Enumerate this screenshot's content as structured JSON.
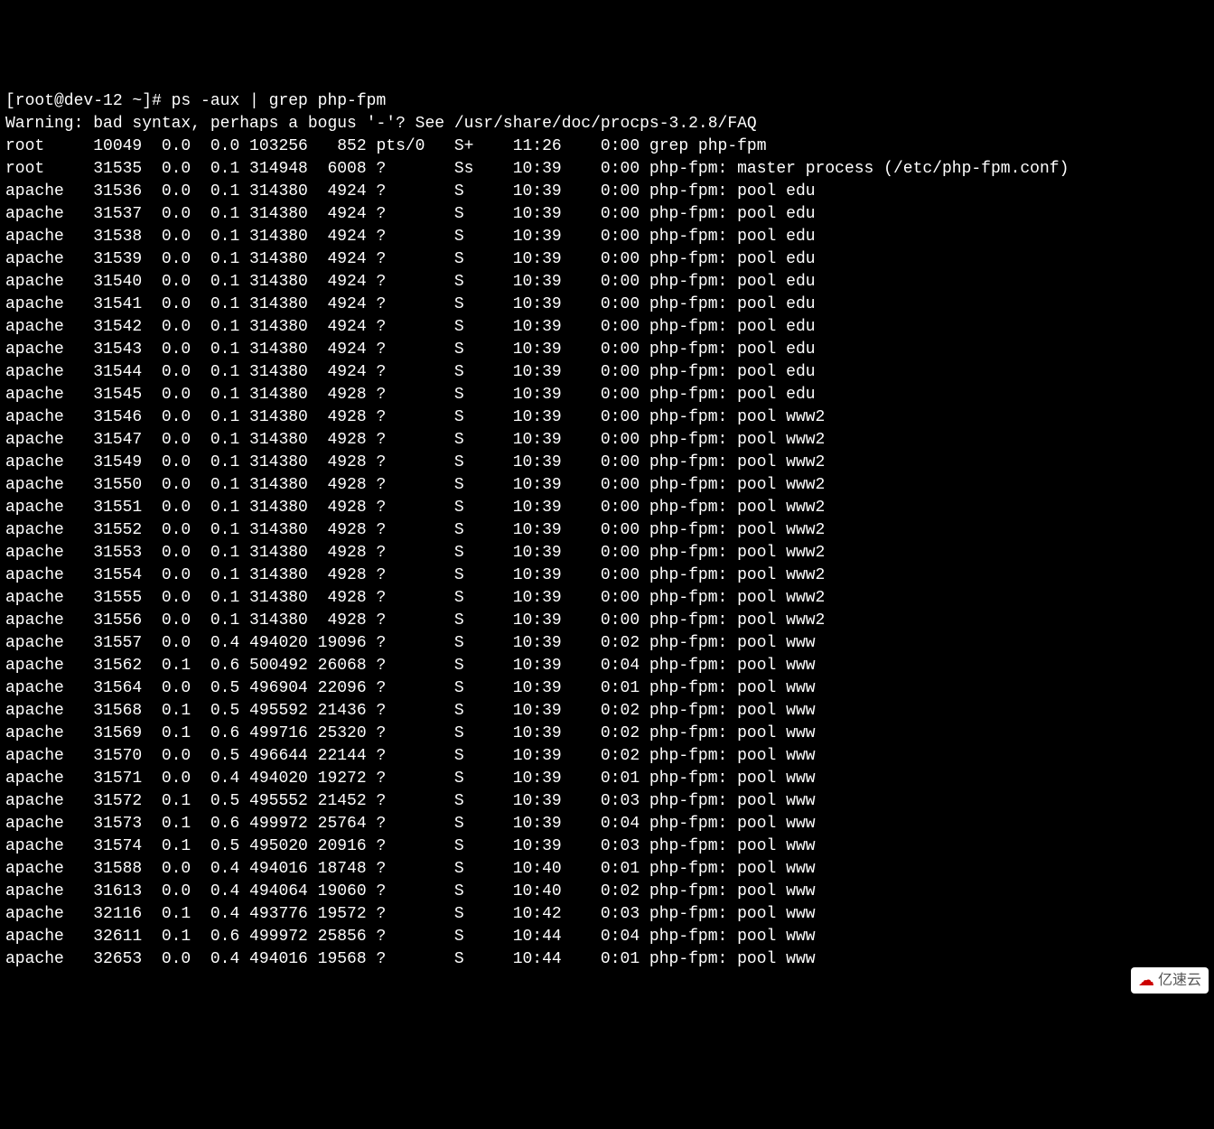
{
  "prompt_line": "[root@dev-12 ~]# ps -aux | grep php-fpm",
  "warning_line": "Warning: bad syntax, perhaps a bogus '-'? See /usr/share/doc/procps-3.2.8/FAQ",
  "rows": [
    {
      "user": "root",
      "pid": "10049",
      "cpu": "0.0",
      "mem": "0.0",
      "vsz": "103256",
      "rss": "852",
      "tty": "pts/0",
      "stat": "S+",
      "start": "11:26",
      "time": "0:00",
      "cmd": "grep php-fpm"
    },
    {
      "user": "root",
      "pid": "31535",
      "cpu": "0.0",
      "mem": "0.1",
      "vsz": "314948",
      "rss": "6008",
      "tty": "?",
      "stat": "Ss",
      "start": "10:39",
      "time": "0:00",
      "cmd": "php-fpm: master process (/etc/php-fpm.conf)"
    },
    {
      "user": "apache",
      "pid": "31536",
      "cpu": "0.0",
      "mem": "0.1",
      "vsz": "314380",
      "rss": "4924",
      "tty": "?",
      "stat": "S",
      "start": "10:39",
      "time": "0:00",
      "cmd": "php-fpm: pool edu"
    },
    {
      "user": "apache",
      "pid": "31537",
      "cpu": "0.0",
      "mem": "0.1",
      "vsz": "314380",
      "rss": "4924",
      "tty": "?",
      "stat": "S",
      "start": "10:39",
      "time": "0:00",
      "cmd": "php-fpm: pool edu"
    },
    {
      "user": "apache",
      "pid": "31538",
      "cpu": "0.0",
      "mem": "0.1",
      "vsz": "314380",
      "rss": "4924",
      "tty": "?",
      "stat": "S",
      "start": "10:39",
      "time": "0:00",
      "cmd": "php-fpm: pool edu"
    },
    {
      "user": "apache",
      "pid": "31539",
      "cpu": "0.0",
      "mem": "0.1",
      "vsz": "314380",
      "rss": "4924",
      "tty": "?",
      "stat": "S",
      "start": "10:39",
      "time": "0:00",
      "cmd": "php-fpm: pool edu"
    },
    {
      "user": "apache",
      "pid": "31540",
      "cpu": "0.0",
      "mem": "0.1",
      "vsz": "314380",
      "rss": "4924",
      "tty": "?",
      "stat": "S",
      "start": "10:39",
      "time": "0:00",
      "cmd": "php-fpm: pool edu"
    },
    {
      "user": "apache",
      "pid": "31541",
      "cpu": "0.0",
      "mem": "0.1",
      "vsz": "314380",
      "rss": "4924",
      "tty": "?",
      "stat": "S",
      "start": "10:39",
      "time": "0:00",
      "cmd": "php-fpm: pool edu"
    },
    {
      "user": "apache",
      "pid": "31542",
      "cpu": "0.0",
      "mem": "0.1",
      "vsz": "314380",
      "rss": "4924",
      "tty": "?",
      "stat": "S",
      "start": "10:39",
      "time": "0:00",
      "cmd": "php-fpm: pool edu"
    },
    {
      "user": "apache",
      "pid": "31543",
      "cpu": "0.0",
      "mem": "0.1",
      "vsz": "314380",
      "rss": "4924",
      "tty": "?",
      "stat": "S",
      "start": "10:39",
      "time": "0:00",
      "cmd": "php-fpm: pool edu"
    },
    {
      "user": "apache",
      "pid": "31544",
      "cpu": "0.0",
      "mem": "0.1",
      "vsz": "314380",
      "rss": "4924",
      "tty": "?",
      "stat": "S",
      "start": "10:39",
      "time": "0:00",
      "cmd": "php-fpm: pool edu"
    },
    {
      "user": "apache",
      "pid": "31545",
      "cpu": "0.0",
      "mem": "0.1",
      "vsz": "314380",
      "rss": "4928",
      "tty": "?",
      "stat": "S",
      "start": "10:39",
      "time": "0:00",
      "cmd": "php-fpm: pool edu"
    },
    {
      "user": "apache",
      "pid": "31546",
      "cpu": "0.0",
      "mem": "0.1",
      "vsz": "314380",
      "rss": "4928",
      "tty": "?",
      "stat": "S",
      "start": "10:39",
      "time": "0:00",
      "cmd": "php-fpm: pool www2"
    },
    {
      "user": "apache",
      "pid": "31547",
      "cpu": "0.0",
      "mem": "0.1",
      "vsz": "314380",
      "rss": "4928",
      "tty": "?",
      "stat": "S",
      "start": "10:39",
      "time": "0:00",
      "cmd": "php-fpm: pool www2"
    },
    {
      "user": "apache",
      "pid": "31549",
      "cpu": "0.0",
      "mem": "0.1",
      "vsz": "314380",
      "rss": "4928",
      "tty": "?",
      "stat": "S",
      "start": "10:39",
      "time": "0:00",
      "cmd": "php-fpm: pool www2"
    },
    {
      "user": "apache",
      "pid": "31550",
      "cpu": "0.0",
      "mem": "0.1",
      "vsz": "314380",
      "rss": "4928",
      "tty": "?",
      "stat": "S",
      "start": "10:39",
      "time": "0:00",
      "cmd": "php-fpm: pool www2"
    },
    {
      "user": "apache",
      "pid": "31551",
      "cpu": "0.0",
      "mem": "0.1",
      "vsz": "314380",
      "rss": "4928",
      "tty": "?",
      "stat": "S",
      "start": "10:39",
      "time": "0:00",
      "cmd": "php-fpm: pool www2"
    },
    {
      "user": "apache",
      "pid": "31552",
      "cpu": "0.0",
      "mem": "0.1",
      "vsz": "314380",
      "rss": "4928",
      "tty": "?",
      "stat": "S",
      "start": "10:39",
      "time": "0:00",
      "cmd": "php-fpm: pool www2"
    },
    {
      "user": "apache",
      "pid": "31553",
      "cpu": "0.0",
      "mem": "0.1",
      "vsz": "314380",
      "rss": "4928",
      "tty": "?",
      "stat": "S",
      "start": "10:39",
      "time": "0:00",
      "cmd": "php-fpm: pool www2"
    },
    {
      "user": "apache",
      "pid": "31554",
      "cpu": "0.0",
      "mem": "0.1",
      "vsz": "314380",
      "rss": "4928",
      "tty": "?",
      "stat": "S",
      "start": "10:39",
      "time": "0:00",
      "cmd": "php-fpm: pool www2"
    },
    {
      "user": "apache",
      "pid": "31555",
      "cpu": "0.0",
      "mem": "0.1",
      "vsz": "314380",
      "rss": "4928",
      "tty": "?",
      "stat": "S",
      "start": "10:39",
      "time": "0:00",
      "cmd": "php-fpm: pool www2"
    },
    {
      "user": "apache",
      "pid": "31556",
      "cpu": "0.0",
      "mem": "0.1",
      "vsz": "314380",
      "rss": "4928",
      "tty": "?",
      "stat": "S",
      "start": "10:39",
      "time": "0:00",
      "cmd": "php-fpm: pool www2"
    },
    {
      "user": "apache",
      "pid": "31557",
      "cpu": "0.0",
      "mem": "0.4",
      "vsz": "494020",
      "rss": "19096",
      "tty": "?",
      "stat": "S",
      "start": "10:39",
      "time": "0:02",
      "cmd": "php-fpm: pool www"
    },
    {
      "user": "apache",
      "pid": "31562",
      "cpu": "0.1",
      "mem": "0.6",
      "vsz": "500492",
      "rss": "26068",
      "tty": "?",
      "stat": "S",
      "start": "10:39",
      "time": "0:04",
      "cmd": "php-fpm: pool www"
    },
    {
      "user": "apache",
      "pid": "31564",
      "cpu": "0.0",
      "mem": "0.5",
      "vsz": "496904",
      "rss": "22096",
      "tty": "?",
      "stat": "S",
      "start": "10:39",
      "time": "0:01",
      "cmd": "php-fpm: pool www"
    },
    {
      "user": "apache",
      "pid": "31568",
      "cpu": "0.1",
      "mem": "0.5",
      "vsz": "495592",
      "rss": "21436",
      "tty": "?",
      "stat": "S",
      "start": "10:39",
      "time": "0:02",
      "cmd": "php-fpm: pool www"
    },
    {
      "user": "apache",
      "pid": "31569",
      "cpu": "0.1",
      "mem": "0.6",
      "vsz": "499716",
      "rss": "25320",
      "tty": "?",
      "stat": "S",
      "start": "10:39",
      "time": "0:02",
      "cmd": "php-fpm: pool www"
    },
    {
      "user": "apache",
      "pid": "31570",
      "cpu": "0.0",
      "mem": "0.5",
      "vsz": "496644",
      "rss": "22144",
      "tty": "?",
      "stat": "S",
      "start": "10:39",
      "time": "0:02",
      "cmd": "php-fpm: pool www"
    },
    {
      "user": "apache",
      "pid": "31571",
      "cpu": "0.0",
      "mem": "0.4",
      "vsz": "494020",
      "rss": "19272",
      "tty": "?",
      "stat": "S",
      "start": "10:39",
      "time": "0:01",
      "cmd": "php-fpm: pool www"
    },
    {
      "user": "apache",
      "pid": "31572",
      "cpu": "0.1",
      "mem": "0.5",
      "vsz": "495552",
      "rss": "21452",
      "tty": "?",
      "stat": "S",
      "start": "10:39",
      "time": "0:03",
      "cmd": "php-fpm: pool www"
    },
    {
      "user": "apache",
      "pid": "31573",
      "cpu": "0.1",
      "mem": "0.6",
      "vsz": "499972",
      "rss": "25764",
      "tty": "?",
      "stat": "S",
      "start": "10:39",
      "time": "0:04",
      "cmd": "php-fpm: pool www"
    },
    {
      "user": "apache",
      "pid": "31574",
      "cpu": "0.1",
      "mem": "0.5",
      "vsz": "495020",
      "rss": "20916",
      "tty": "?",
      "stat": "S",
      "start": "10:39",
      "time": "0:03",
      "cmd": "php-fpm: pool www"
    },
    {
      "user": "apache",
      "pid": "31588",
      "cpu": "0.0",
      "mem": "0.4",
      "vsz": "494016",
      "rss": "18748",
      "tty": "?",
      "stat": "S",
      "start": "10:40",
      "time": "0:01",
      "cmd": "php-fpm: pool www"
    },
    {
      "user": "apache",
      "pid": "31613",
      "cpu": "0.0",
      "mem": "0.4",
      "vsz": "494064",
      "rss": "19060",
      "tty": "?",
      "stat": "S",
      "start": "10:40",
      "time": "0:02",
      "cmd": "php-fpm: pool www"
    },
    {
      "user": "apache",
      "pid": "32116",
      "cpu": "0.1",
      "mem": "0.4",
      "vsz": "493776",
      "rss": "19572",
      "tty": "?",
      "stat": "S",
      "start": "10:42",
      "time": "0:03",
      "cmd": "php-fpm: pool www"
    },
    {
      "user": "apache",
      "pid": "32611",
      "cpu": "0.1",
      "mem": "0.6",
      "vsz": "499972",
      "rss": "25856",
      "tty": "?",
      "stat": "S",
      "start": "10:44",
      "time": "0:04",
      "cmd": "php-fpm: pool www"
    },
    {
      "user": "apache",
      "pid": "32653",
      "cpu": "0.0",
      "mem": "0.4",
      "vsz": "494016",
      "rss": "19568",
      "tty": "?",
      "stat": "S",
      "start": "10:44",
      "time": "0:01",
      "cmd": "php-fpm: pool www"
    }
  ],
  "watermark": "亿速云"
}
